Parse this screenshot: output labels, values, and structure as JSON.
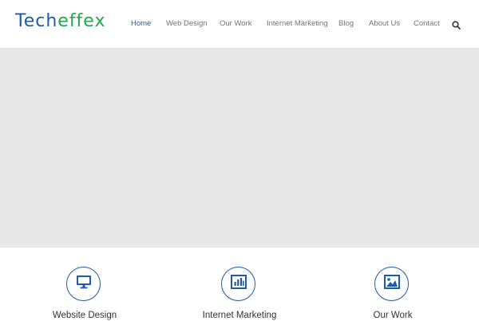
{
  "brand": {
    "part1": "Tech",
    "part2": "effex",
    "color_primary": "#1f5aa6",
    "color_accent": "#22a84a"
  },
  "nav": {
    "items": [
      {
        "label": "Home",
        "active": true
      },
      {
        "label": "Web Design",
        "active": false
      },
      {
        "label": "Our Work",
        "active": false
      },
      {
        "label": "Internet Marketing",
        "active": false
      },
      {
        "label": "Blog",
        "active": false
      },
      {
        "label": "About Us",
        "active": false
      },
      {
        "label": "Contact",
        "active": false
      }
    ],
    "search_icon": "search-icon"
  },
  "features": [
    {
      "label": "Website Design",
      "icon": "monitor-icon"
    },
    {
      "label": "Internet Marketing",
      "icon": "bar-chart-icon"
    },
    {
      "label": "Our Work",
      "icon": "image-icon"
    }
  ]
}
